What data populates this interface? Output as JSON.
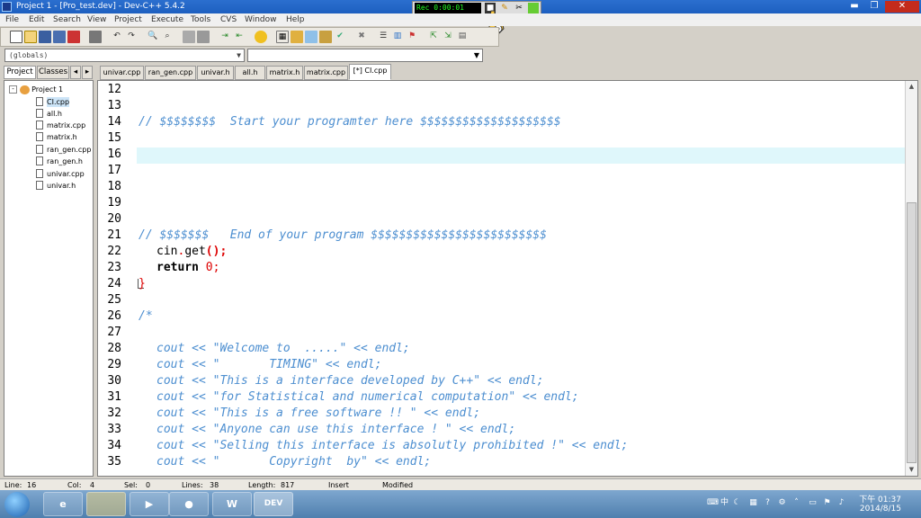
{
  "window": {
    "title": "Project 1 - [Pro_test.dev] - Dev-C++ 5.4.2"
  },
  "recorder": {
    "time": "Rec 0:00:01"
  },
  "menu": [
    "File",
    "Edit",
    "Search",
    "View",
    "Project",
    "Execute",
    "Tools",
    "CVS",
    "Window",
    "Help"
  ],
  "scope_combo": {
    "value": "(globals)"
  },
  "left_tabs": [
    "Project",
    "Classes"
  ],
  "project": {
    "root": "Project 1",
    "files": [
      "CI.cpp",
      "all.h",
      "matrix.cpp",
      "matrix.h",
      "ran_gen.cpp",
      "ran_gen.h",
      "univar.cpp",
      "univar.h"
    ]
  },
  "file_tabs": [
    "univar.cpp",
    "ran_gen.cpp",
    "univar.h",
    "all.h",
    "matrix.h",
    "matrix.cpp",
    "[*] CI.cpp"
  ],
  "editor": {
    "line_numbers": [
      "12",
      "13",
      "14",
      "15",
      "16",
      "17",
      "18",
      "19",
      "20",
      "21",
      "22",
      "23",
      "24",
      "25",
      "26",
      "27",
      "28",
      "29",
      "30",
      "31",
      "32",
      "33",
      "34",
      "35"
    ],
    "l14": "// $$$$$$$$  Start your programter here $$$$$$$$$$$$$$$$$$$$",
    "l21": "// $$$$$$$   End of your program $$$$$$$$$$$$$$$$$$$$$$$$$",
    "l22a": "cin",
    "l22b": ".",
    "l22c": "get",
    "l22d": "();",
    "l23a": "return",
    "l23b": "0",
    "l23c": ";",
    "l24": "}",
    "l26": "/*",
    "l28": "cout << \"Welcome to  .....\" << endl;",
    "l29": "cout << \"       TIMING\" << endl;",
    "l30": "cout << \"This is a interface developed by C++\" << endl;",
    "l31": "cout << \"for Statistical and numerical computation\" << endl;",
    "l32": "cout << \"This is a free software !! \" << endl;",
    "l33": "cout << \"Anyone can use this interface ! \" << endl;",
    "l34": "cout << \"Selling this interface is absolutly prohibited !\" << endl;",
    "l35": "cout << \"       Copyright  by\" << endl;"
  },
  "status": {
    "line_label": "Line:",
    "line": "16",
    "col_label": "Col:",
    "col": "4",
    "sel_label": "Sel:",
    "sel": "0",
    "lines_label": "Lines:",
    "lines": "38",
    "length_label": "Length:",
    "length": "817",
    "mode": "Insert",
    "state": "Modified"
  },
  "taskbar": {
    "clock_time": "下午 01:37",
    "clock_date": "2014/8/15",
    "word_label": "W",
    "devcpp_label": "DEV"
  },
  "colors": {
    "comment": "#4c8ed0",
    "string_red": "#dd0000",
    "current_line": "#dff7fb",
    "titlebar": "#2b6fcf"
  }
}
